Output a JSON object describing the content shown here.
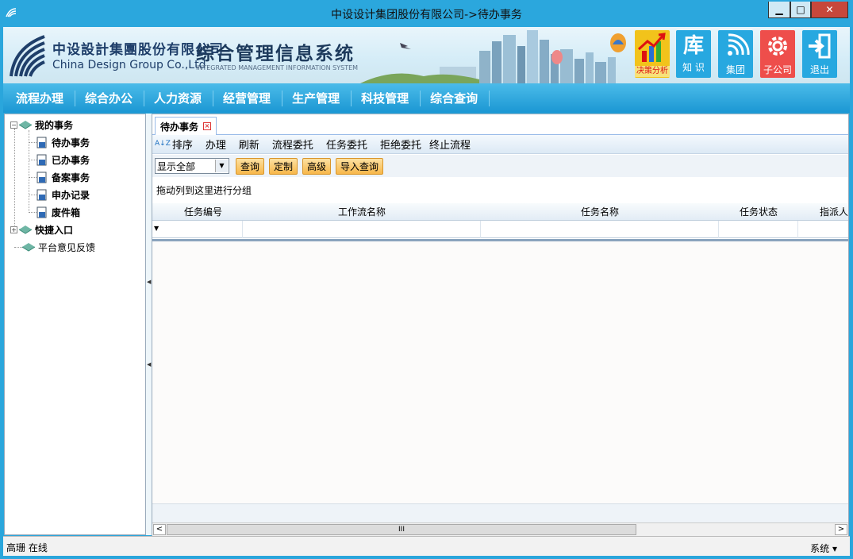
{
  "window": {
    "title": "中设设计集团股份有限公司->待办事务",
    "minimize_label": "▁",
    "maximize_label": "□",
    "close_label": "✕"
  },
  "banner": {
    "company_cn": "中设設計集團股份有限公司",
    "company_en": "China Design Group Co.,Ltd.",
    "system_name": "综合管理信息系统",
    "system_name_en": "INTEGRATED MANAGEMENT INFORMATION SYSTEM",
    "buttons": [
      {
        "label": "决策分析",
        "icon": "chart-up-icon"
      },
      {
        "label": "知 识",
        "glyph": "库",
        "icon": "knowledge-icon"
      },
      {
        "label": "集团",
        "icon": "rss-icon"
      },
      {
        "label": "子公司",
        "icon": "gear-icon"
      },
      {
        "label": "退出",
        "icon": "exit-icon"
      }
    ]
  },
  "menu": [
    "流程办理",
    "综合办公",
    "人力资源",
    "经营管理",
    "生产管理",
    "科技管理",
    "综合查询"
  ],
  "sidebar": {
    "root": "我的事务",
    "items": [
      "待办事务",
      "已办事务",
      "备案事务",
      "申办记录",
      "废件箱"
    ],
    "quick": "快捷入口",
    "feedback": "平台意见反馈",
    "collapse_glyph": "−",
    "expand_glyph": "+"
  },
  "tab": {
    "label": "待办事务",
    "close_glyph": "×"
  },
  "toolbar": {
    "sort_glyph": "A↓Z",
    "items": [
      "排序",
      "办理",
      "刷新",
      "流程委托",
      "任务委托",
      "拒绝委托",
      "终止流程"
    ]
  },
  "filter": {
    "select_value": "显示全部",
    "buttons": [
      "查询",
      "定制",
      "高级",
      "导入查询"
    ]
  },
  "grid": {
    "group_hint": "拖动列到这里进行分组",
    "columns": [
      "任务编号",
      "工作流名称",
      "任务名称",
      "任务状态",
      "指派人"
    ]
  },
  "scrollbar": {
    "left": "<",
    "right": ">",
    "thumb": "III"
  },
  "status": {
    "user": "高珊 在线",
    "system": "系统 ▾"
  },
  "colors": {
    "accent": "#2aa6dc",
    "menu": "#1b97d3",
    "button_orange": "#f7b74a"
  }
}
